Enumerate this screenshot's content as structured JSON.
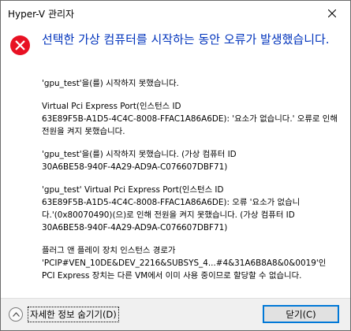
{
  "window": {
    "title": "Hyper-V 관리자"
  },
  "dialog": {
    "main_instruction": "선택한 가상 컴퓨터를 시작하는 동안 오류가 발생했습니다.",
    "details": [
      "'gpu_test'을(를) 시작하지 못했습니다.",
      "Virtual Pci Express Port(인스턴스 ID\n63E89F5B-A1D5-4C4C-8008-FFAC1A86A6DE): '요소가 없습니다.' 오류로 인해 전원을 켜지 못했습니다.",
      "'gpu_test'을(를) 시작하지 못했습니다. (가상 컴퓨터 ID\n30A6BE58-940F-4A29-AD9A-C076607DBF71)",
      "'gpu_test' Virtual Pci Express Port(인스턴스 ID\n63E89F5B-A1D5-4C4C-8008-FFAC1A86A6DE): 오류 '요소가 없습니다.'(0x80070490)(으)로 인해 전원을 켜지 못했습니다. (가상 컴퓨터 ID\n30A6BE58-940F-4A29-AD9A-C076607DBF71)",
      "플러그 앤 플레이 장치 인스턴스 경로가\n'PCIP#VEN_10DE&DEV_2216&SUBSYS_4...#4&31A6B8A8&0&0019'인 PCI Express 장치는 다른 VM에서 이미 사용 중이므로 할당할 수 없습니다."
    ]
  },
  "footer": {
    "toggle_label": "자세한 정보 숨기기(D)",
    "close_label": "닫기(C)"
  },
  "icons": {
    "error": "error-x-circle-icon",
    "title_close": "close-icon",
    "toggle": "chevron-up-icon"
  },
  "colors": {
    "error_red": "#e81123",
    "instruction_blue": "#0033bc",
    "footer_bg": "#f0f0f0",
    "button_border": "#0078d7"
  }
}
